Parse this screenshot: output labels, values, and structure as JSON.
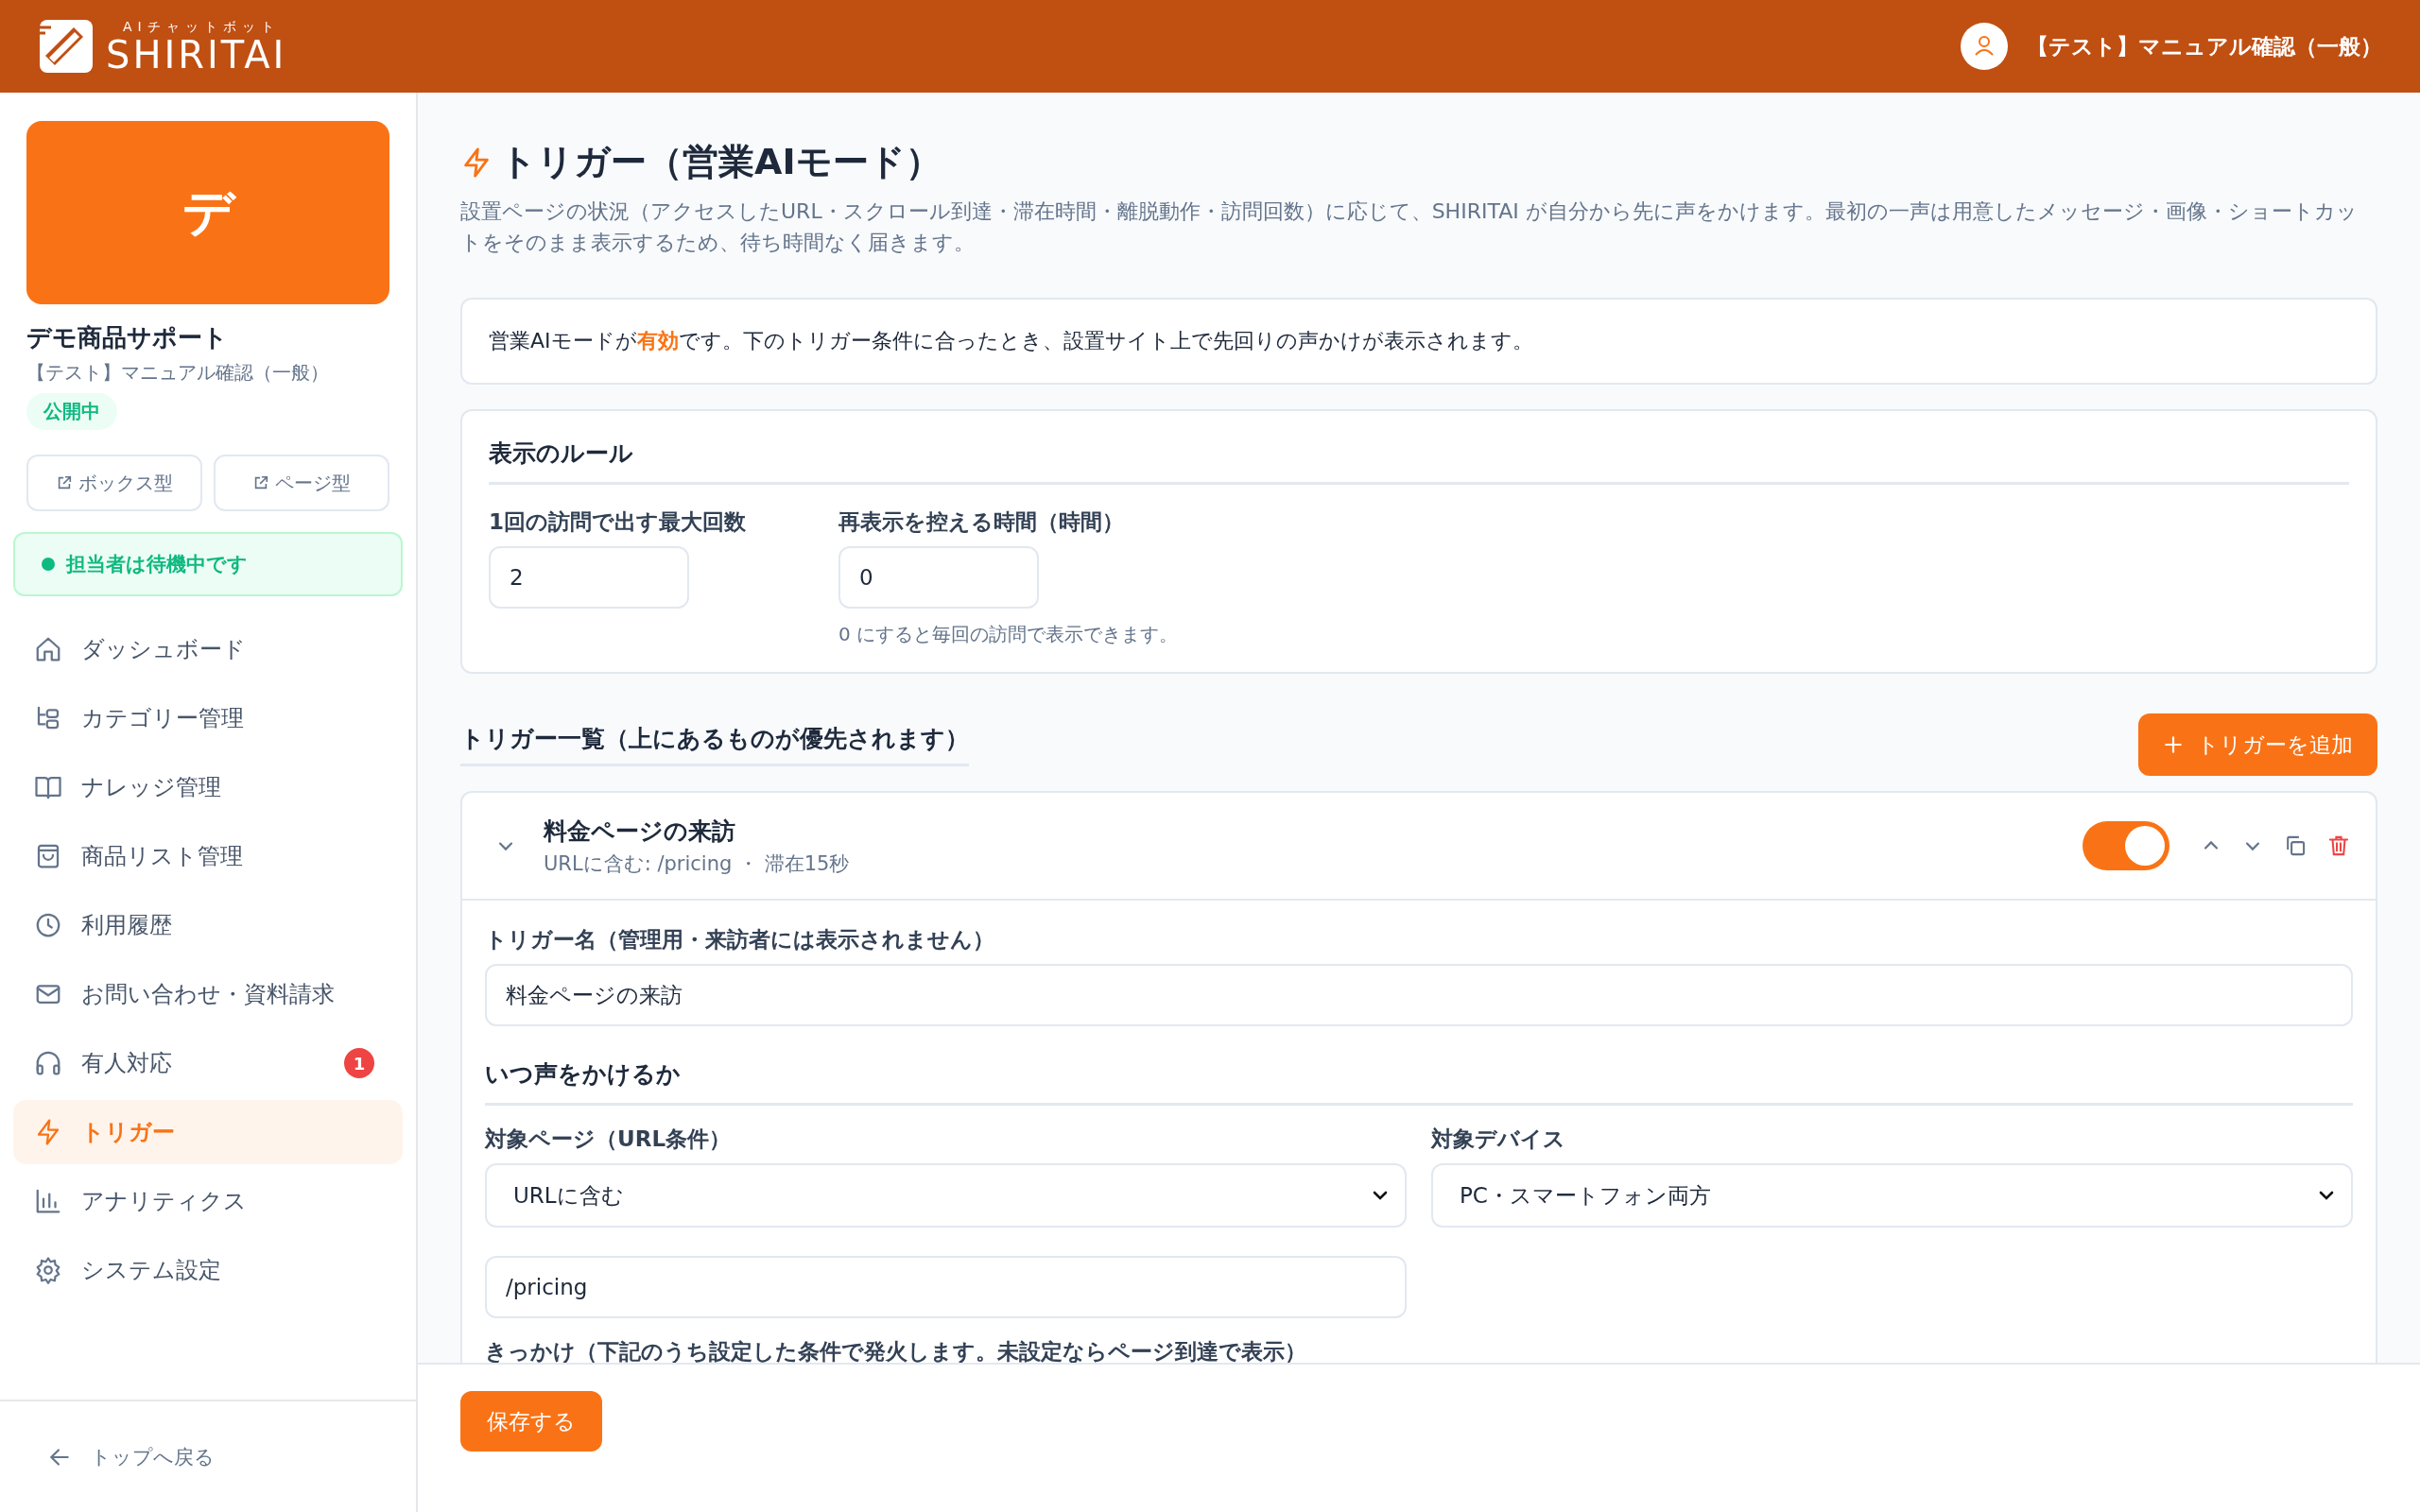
{
  "header": {
    "logo_tagline": "AIチャットボット",
    "logo_text": "SHIRITAI",
    "user_name": "【テスト】マニュアル確認（一般）"
  },
  "sidebar": {
    "avatar_letter": "デ",
    "bot_name": "デモ商品サポート",
    "bot_subtitle": "【テスト】マニュアル確認（一般）",
    "status_badge": "公開中",
    "preview_buttons": [
      "ボックス型",
      "ページ型"
    ],
    "agent_status": {
      "text": "担当者は待機中です",
      "online": true
    },
    "items": [
      {
        "label": "ダッシュボード",
        "selected": false
      },
      {
        "label": "カテゴリー管理",
        "selected": false
      },
      {
        "label": "ナレッジ管理",
        "selected": false
      },
      {
        "label": "商品リスト管理",
        "selected": false
      },
      {
        "label": "利用履歴",
        "selected": false
      },
      {
        "label": "お問い合わせ・資料請求",
        "selected": false
      },
      {
        "label": "有人対応",
        "selected": false,
        "badge": "1"
      },
      {
        "label": "トリガー",
        "selected": true
      },
      {
        "label": "アナリティクス",
        "selected": false
      },
      {
        "label": "システム設定",
        "selected": false
      }
    ],
    "back_link": "トップへ戻る"
  },
  "page": {
    "title": "トリガー（営業AIモード）",
    "description": "設置ページの状況（アクセスしたURL・スクロール到達・滞在時間・離脱動作・訪問回数）に応じて、SHIRITAI が自分から先に声をかけます。最初の一声は用意したメッセージ・画像・ショートカットをそのまま表示するため、待ち時間なく届きます。",
    "notice": "営業AIモードが**有効**です。下のトリガー条件に合ったとき、設置サイト上で先回りの声かけが表示されます。",
    "display_rules": {
      "heading": "表示のルール",
      "fields": [
        {
          "label": "1回の訪問で出す最大回数",
          "value": "2"
        },
        {
          "label": "再表示を控える時間（時間）",
          "value": "0",
          "hint": "0 にすると毎回の訪問で表示できます。"
        }
      ]
    },
    "trigger_list": {
      "heading": "トリガー一覧（上にあるものが優先されます）",
      "add_button": "トリガーを追加",
      "triggers": [
        {
          "name": "料金ページの来訪",
          "summary": "URLに含む: /pricing ・ 滞在15秒",
          "expanded": true,
          "enabled": true,
          "form": {
            "name_label": "トリガー名（管理用・来訪者には表示されません）",
            "name_value": "料金ページの来訪",
            "section_heading": "いつ声をかけるか",
            "page_label": "対象ページ（URL条件）",
            "url_match": "URLに含む",
            "device_label": "対象デバイス",
            "device": "PC・スマートフォン両方",
            "url_value": "/pricing",
            "trigger_label": "きっかけ（下記のうち設定した条件で発火します。未設定ならページ到達で表示）"
          }
        }
      ]
    },
    "save_button": "保存する"
  }
}
